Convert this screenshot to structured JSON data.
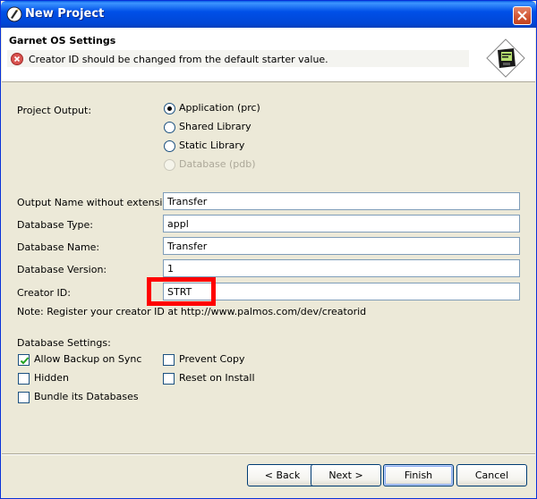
{
  "window": {
    "title": "New Project"
  },
  "header": {
    "title": "Garnet OS Settings",
    "message": "Creator ID should be changed from the default starter value."
  },
  "project_output": {
    "label": "Project Output:",
    "options": [
      {
        "label": "Application (prc)",
        "selected": true,
        "enabled": true
      },
      {
        "label": "Shared Library",
        "selected": false,
        "enabled": true
      },
      {
        "label": "Static Library",
        "selected": false,
        "enabled": true
      },
      {
        "label": "Database (pdb)",
        "selected": false,
        "enabled": false
      }
    ]
  },
  "fields": {
    "output_name": {
      "label": "Output Name without extension:",
      "value": "Transfer"
    },
    "db_type": {
      "label": "Database Type:",
      "value": "appl"
    },
    "db_name": {
      "label": "Database Name:",
      "value": "Transfer"
    },
    "db_version": {
      "label": "Database Version:",
      "value": "1"
    },
    "creator_id": {
      "label": "Creator ID:",
      "value": "STRT"
    }
  },
  "note": "Note: Register your creator ID at http://www.palmos.com/dev/creatorid",
  "db_settings": {
    "label": "Database Settings:",
    "allow_backup": {
      "label": "Allow Backup on Sync",
      "checked": true
    },
    "hidden": {
      "label": "Hidden",
      "checked": false
    },
    "bundle": {
      "label": "Bundle its Databases",
      "checked": false
    },
    "prevent_copy": {
      "label": "Prevent Copy",
      "checked": false
    },
    "reset_on_install": {
      "label": "Reset on Install",
      "checked": false
    }
  },
  "buttons": {
    "back": "< Back",
    "next": "Next >",
    "finish": "Finish",
    "cancel": "Cancel"
  },
  "colors": {
    "title_bar": "#0050e8",
    "close_button": "#d45b3a",
    "highlight": "#ff0000",
    "error_icon": "#d9534f"
  }
}
